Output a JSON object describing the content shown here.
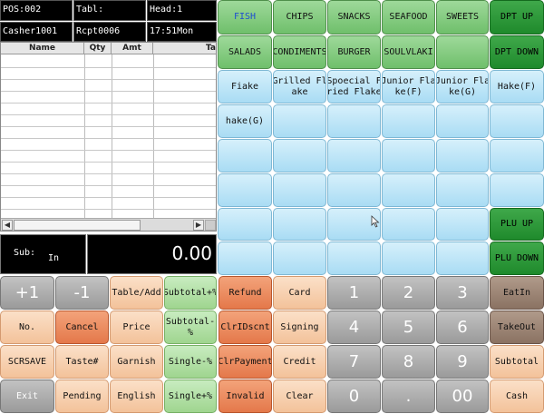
{
  "header": {
    "pos": "POS:002",
    "table": "Tabl:",
    "head": "Head:1",
    "cashier": "Casher1001",
    "receipt": "Rcpt0006",
    "time": "17:51Mon"
  },
  "order_table": {
    "columns": [
      "Name",
      "Qty",
      "Amt",
      "Ta"
    ]
  },
  "subtotal": {
    "sub_label": "Sub:",
    "in_label": "In",
    "total": "0.00"
  },
  "categories": {
    "row1": [
      "FISH",
      "CHIPS",
      "SNACKS",
      "SEAFOOD",
      "SWEETS"
    ],
    "row2": [
      "SALADS",
      "CONDIMENTS",
      "BURGER",
      "SOULVLAKI",
      ""
    ],
    "dept_up": "DPT UP",
    "dept_down": "DPT DOWN"
  },
  "plu": {
    "items": [
      "Fiake",
      "Grilled Fl\nake",
      "Spoecial F\nried Flake",
      "Junior Fla\nke(F)",
      "Junior Fla\nke(G)",
      "hake(G)"
    ],
    "side_item": "Hake(F)",
    "plu_up": "PLU UP",
    "plu_down": "PLU DOWN"
  },
  "keypad": {
    "left": [
      [
        "+1",
        "-1",
        "Table/Add",
        "Subtotal+%"
      ],
      [
        "No.",
        "Cancel",
        "Price",
        "Subtotal-%"
      ],
      [
        "SCRSAVE",
        "Taste#",
        "Garnish",
        "Single-%"
      ],
      [
        "Exit",
        "Pending",
        "English",
        "Single+%"
      ]
    ],
    "mid": [
      [
        "Refund",
        "Card"
      ],
      [
        "ClrIDscnt",
        "Signing"
      ],
      [
        "ClrPayment",
        "Credit"
      ],
      [
        "Invalid",
        "Clear"
      ]
    ],
    "digits": [
      [
        "1",
        "2",
        "3"
      ],
      [
        "4",
        "5",
        "6"
      ],
      [
        "7",
        "8",
        "9"
      ],
      [
        "0",
        ".",
        "00"
      ]
    ],
    "right": [
      "EatIn",
      "TakeOut",
      "Subtotal",
      "Cash"
    ]
  },
  "colors": {
    "category_green": "#7fca7a",
    "dept_dark_green": "#2a9a38",
    "plu_blue": "#bfe6f8",
    "keypad_peach": "#f6cda8",
    "keypad_orange": "#ea8a5c",
    "keypad_gray": "#aaaaaa",
    "keypad_brown": "#9c8272"
  }
}
